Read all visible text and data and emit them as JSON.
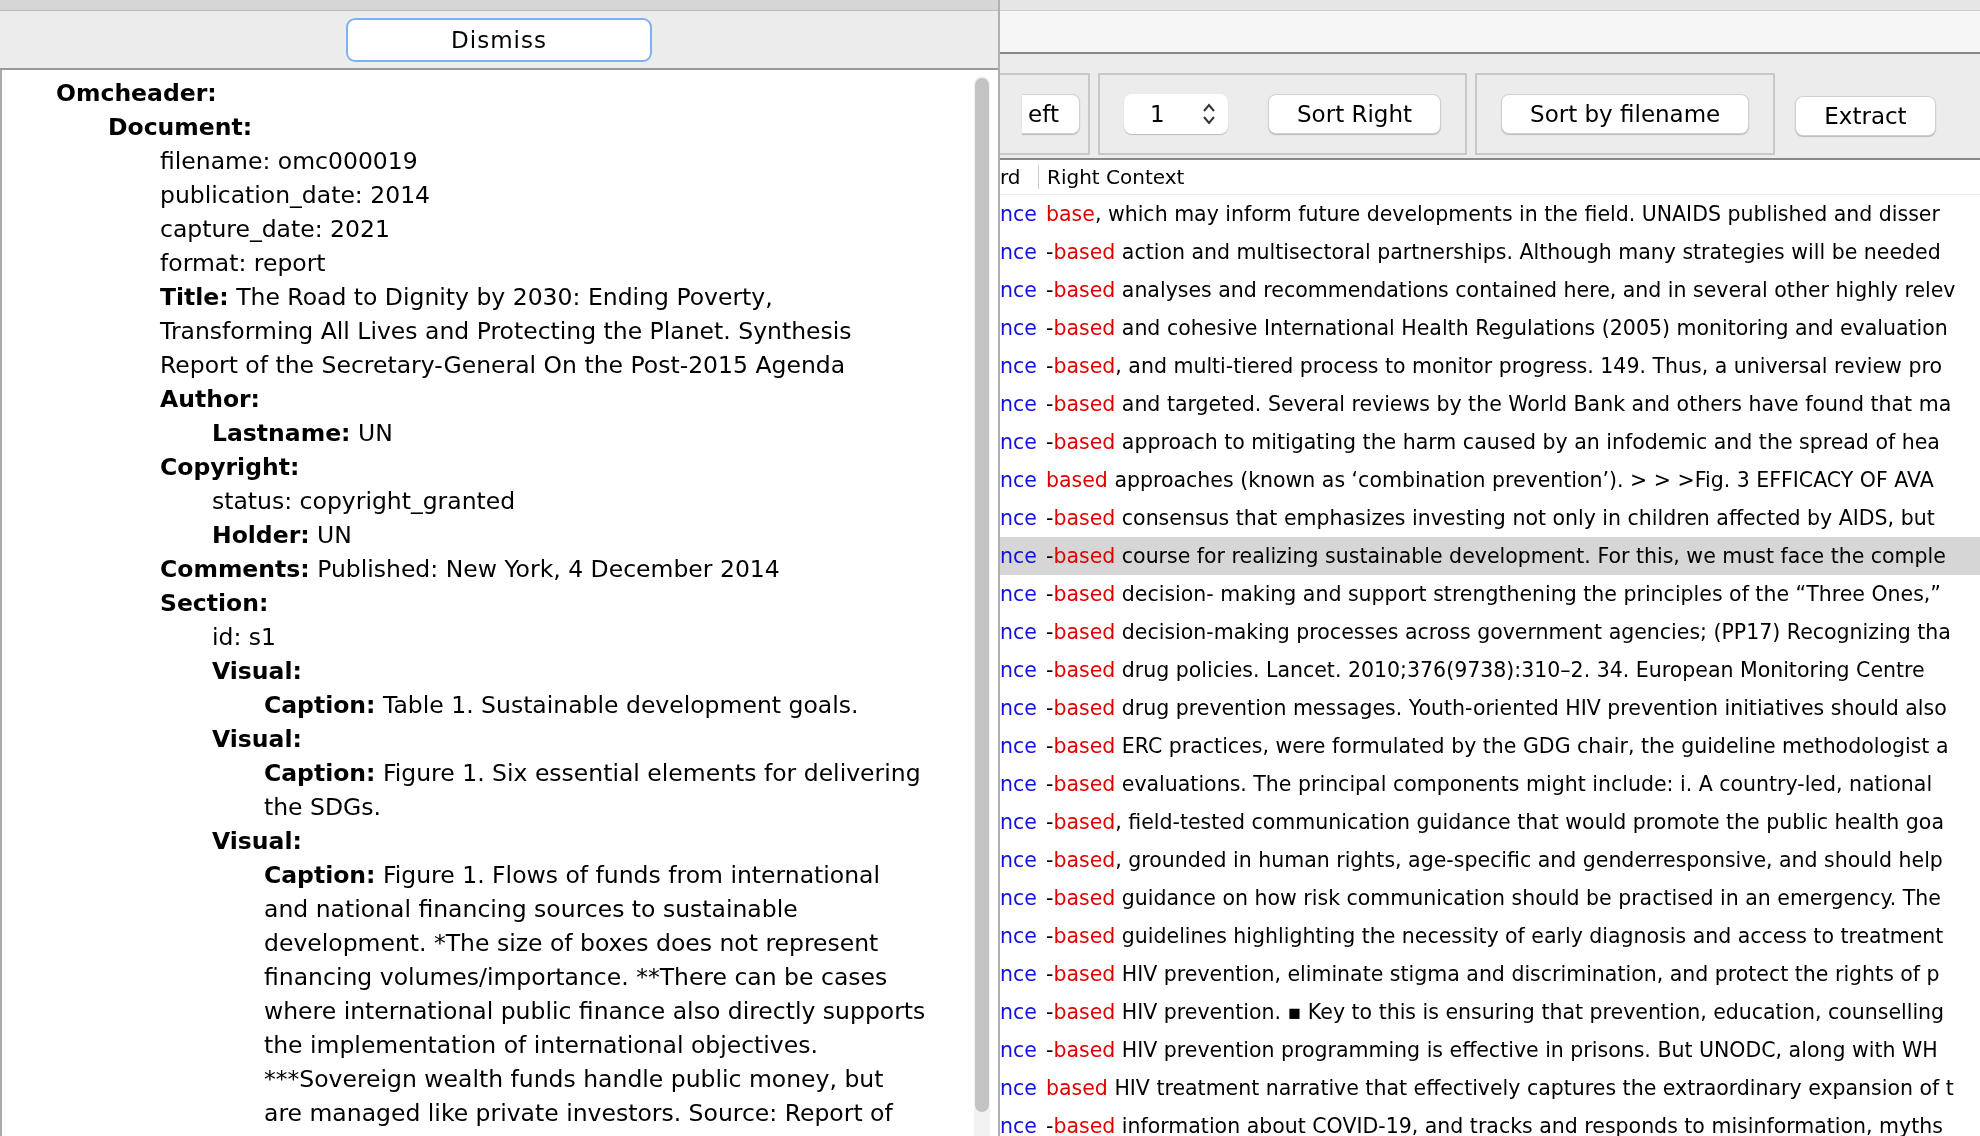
{
  "dialog": {
    "dismiss_button": "Dismiss",
    "tree": [
      {
        "kind": "section",
        "text": "Omcheader:",
        "children": [
          {
            "kind": "section",
            "text": "Document:",
            "children": [
              {
                "kind": "field",
                "text": "filename: omc000019"
              },
              {
                "kind": "field",
                "text": "publication_date: 2014"
              },
              {
                "kind": "field",
                "text": "capture_date: 2021"
              },
              {
                "kind": "field",
                "text": "format: report"
              },
              {
                "kind": "labeled",
                "key": "Title:",
                "value": "The Road to Dignity by 2030: Ending Poverty, Transforming All Lives and Protecting the Planet. Synthesis Report of the Secretary-General On the Post-2015 Agenda"
              },
              {
                "kind": "section",
                "text": "Author:",
                "children": [
                  {
                    "kind": "labeled",
                    "key": "Lastname:",
                    "value": "UN"
                  }
                ]
              },
              {
                "kind": "section",
                "text": "Copyright:",
                "children": [
                  {
                    "kind": "field",
                    "text": "status: copyright_granted"
                  },
                  {
                    "kind": "labeled",
                    "key": "Holder:",
                    "value": "UN"
                  }
                ]
              },
              {
                "kind": "labeled",
                "key": "Comments:",
                "value": "Published: New York, 4 December 2014"
              },
              {
                "kind": "section",
                "text": "Section:",
                "children": [
                  {
                    "kind": "field",
                    "text": "id: s1"
                  },
                  {
                    "kind": "section",
                    "text": "Visual:",
                    "children": [
                      {
                        "kind": "labeled",
                        "key": "Caption:",
                        "value": "Table 1. Sustainable development goals."
                      }
                    ]
                  },
                  {
                    "kind": "section",
                    "text": "Visual:",
                    "children": [
                      {
                        "kind": "labeled",
                        "key": "Caption:",
                        "value": "Figure 1. Six essential elements for delivering the SDGs."
                      }
                    ]
                  },
                  {
                    "kind": "section",
                    "text": "Visual:",
                    "children": [
                      {
                        "kind": "labeled",
                        "key": "Caption:",
                        "value": "Figure 1. Flows of funds from international and national financing sources to sustainable development. *The size of boxes does not represent financing volumes/importance. **There can be cases where international public finance also directly supports the implementation of international objectives. ***Sovereign wealth funds handle public money, but are managed like private investors. Source: Report of"
                      }
                    ]
                  }
                ]
              }
            ]
          }
        ]
      }
    ]
  },
  "toolbar": {
    "buttons_left": [
      "eft"
    ],
    "spinner": "1",
    "sort_right": "Sort Right",
    "sort_filename": "Sort by filename",
    "extract": "Extract"
  },
  "table": {
    "columns": [
      "rd",
      "Right Context"
    ],
    "rows": [
      {
        "keyword": "nce",
        "prefix": "",
        "node": "base",
        "context": ", which may inform future developments in the field. UNAIDS published and disser",
        "selected": false
      },
      {
        "keyword": "nce",
        "prefix": "-",
        "node": "based",
        "context": " action and multisectoral partnerships. Although many strategies will be needed",
        "selected": false
      },
      {
        "keyword": "nce",
        "prefix": "-",
        "node": "based",
        "context": " analyses and recommendations contained here, and in several other highly relev",
        "selected": false
      },
      {
        "keyword": "nce",
        "prefix": "-",
        "node": "based",
        "context": " and cohesive International Health Regulations (2005) monitoring and evaluation",
        "selected": false
      },
      {
        "keyword": "nce",
        "prefix": "-",
        "node": "based",
        "context": ", and multi-tiered process to monitor progress. 149. Thus, a universal review pro",
        "selected": false
      },
      {
        "keyword": "nce",
        "prefix": "-",
        "node": "based",
        "context": " and targeted. Several reviews by the World Bank and others have found that ma",
        "selected": false
      },
      {
        "keyword": "nce",
        "prefix": "-",
        "node": "based",
        "context": " approach to mitigating the harm caused by an infodemic and the spread of hea",
        "selected": false
      },
      {
        "keyword": "nce",
        "prefix": "",
        "node": "based",
        "context": " approaches (known as ‘combination prevention’). > > >Fig. 3 EFFICACY OF AVA",
        "selected": false
      },
      {
        "keyword": "nce",
        "prefix": "-",
        "node": "based",
        "context": " consensus that emphasizes investing not only in children affected by AIDS, but",
        "selected": false
      },
      {
        "keyword": "nce",
        "prefix": "-",
        "node": "based",
        "context": " course for realizing sustainable development. For this, we must face the comple",
        "selected": true
      },
      {
        "keyword": "nce",
        "prefix": "-",
        "node": "based",
        "context": " decision- making and support strengthening the principles of the “Three Ones,”",
        "selected": false
      },
      {
        "keyword": "nce",
        "prefix": "-",
        "node": "based",
        "context": " decision-making processes across government agencies; (PP17) Recognizing tha",
        "selected": false
      },
      {
        "keyword": "nce",
        "prefix": "-",
        "node": "based",
        "context": " drug policies. Lancet. 2010;376(9738):310–2. 34. European Monitoring Centre",
        "selected": false
      },
      {
        "keyword": "nce",
        "prefix": "-",
        "node": "based",
        "context": " drug prevention messages. Youth-oriented HIV prevention initiatives should also",
        "selected": false
      },
      {
        "keyword": "nce",
        "prefix": "-",
        "node": "based",
        "context": " ERC practices, were formulated by the GDG chair, the guideline methodologist a",
        "selected": false
      },
      {
        "keyword": "nce",
        "prefix": "-",
        "node": "based",
        "context": " evaluations. The principal components might include: i. A country-led, national",
        "selected": false
      },
      {
        "keyword": "nce",
        "prefix": "-",
        "node": "based",
        "context": ", field-tested communication guidance that would promote the public health goa",
        "selected": false
      },
      {
        "keyword": "nce",
        "prefix": "-",
        "node": "based",
        "context": ", grounded in human rights, age-specific and genderresponsive, and should help",
        "selected": false
      },
      {
        "keyword": "nce",
        "prefix": "-",
        "node": "based",
        "context": " guidance on how risk communication should be practised in an emergency. The",
        "selected": false
      },
      {
        "keyword": "nce",
        "prefix": "-",
        "node": "based",
        "context": " guidelines highlighting the necessity of early diagnosis and access to treatment",
        "selected": false
      },
      {
        "keyword": "nce",
        "prefix": "-",
        "node": "based",
        "context": " HIV prevention, eliminate stigma and discrimination, and protect the rights of p",
        "selected": false
      },
      {
        "keyword": "nce",
        "prefix": "-",
        "node": "based",
        "context": " HIV prevention. ▪ Key to this is ensuring that prevention, education, counselling",
        "selected": false
      },
      {
        "keyword": "nce",
        "prefix": "-",
        "node": "based",
        "context": " HIV prevention programming is effective in prisons. But UNODC, along with WH",
        "selected": false
      },
      {
        "keyword": "nce",
        "prefix": "",
        "node": "based",
        "context": " HIV treatment narrative that effectively captures the extraordinary expansion of t",
        "selected": false
      },
      {
        "keyword": "nce",
        "prefix": "-",
        "node": "based",
        "context": " information about COVID-19, and tracks and responds to misinformation, myths",
        "selected": false
      }
    ]
  }
}
